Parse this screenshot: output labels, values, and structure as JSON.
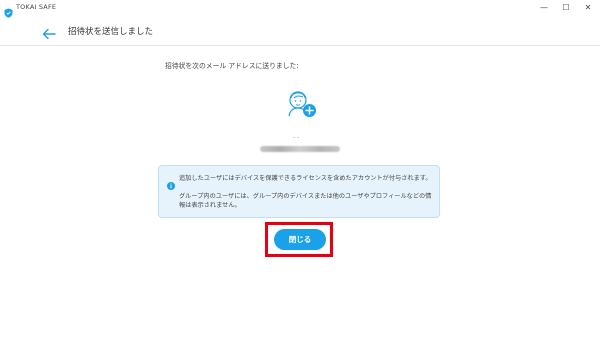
{
  "window": {
    "app_title": "TOKAI SAFE",
    "minimize_glyph": "—",
    "maximize_glyph": "☐",
    "close_glyph": "✕"
  },
  "header": {
    "back_icon": "arrow-left-icon",
    "title": "招待状を送信しました"
  },
  "main": {
    "intro": "招待状を次のメール アドレスに送りました:",
    "avatar_icon": "user-add-icon",
    "name_placeholder": "- -",
    "email_blurred": ""
  },
  "notice": {
    "icon": "info-icon",
    "line1": "追加したユーザにはデバイスを保護できるライセンスを含めたアカウントが付与されます。",
    "line2": "グループ内のユーザには、グループ内のデバイスまたは他のユーザやプロフィールなどの情報は表示されません。"
  },
  "actions": {
    "close_label": "閉じる"
  },
  "colors": {
    "accent": "#1ba1ea",
    "notice_bg": "#e6f3fc",
    "highlight": "#e60012"
  }
}
